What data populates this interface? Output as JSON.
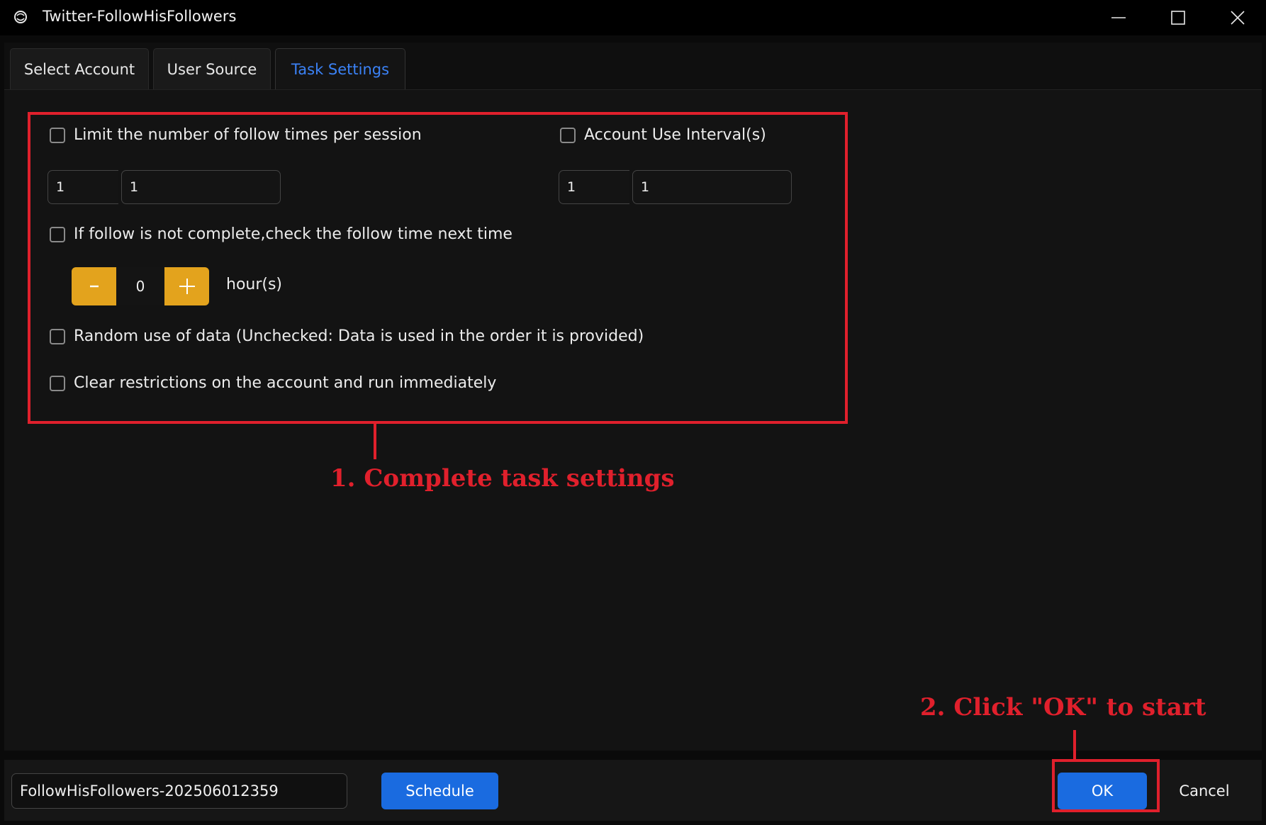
{
  "window": {
    "title": "Twitter-FollowHisFollowers",
    "icon": "app-logo-icon"
  },
  "tabs": [
    {
      "label": "Select Account",
      "active": false
    },
    {
      "label": "User Source",
      "active": false
    },
    {
      "label": "Task Settings",
      "active": true
    }
  ],
  "settings": {
    "limit_follow": {
      "label": "Limit the number of follow times per session",
      "checked": false,
      "min": "1",
      "max": "1"
    },
    "account_interval": {
      "label": "Account Use Interval(s)",
      "checked": false,
      "min": "1",
      "max": "1"
    },
    "follow_incomplete": {
      "label": "If follow is not complete,check the follow time next time",
      "checked": false,
      "hours": "0",
      "hours_label": "hour(s)"
    },
    "random_data": {
      "label": "Random use of data (Unchecked: Data is used in the order it is provided)",
      "checked": false
    },
    "clear_restrictions": {
      "label": "Clear restrictions on the account and run immediately",
      "checked": false
    }
  },
  "annotations": {
    "step1": "1. Complete task settings",
    "step2": "2. Click \"OK\" to start",
    "highlight_color": "#e0202c"
  },
  "footer": {
    "task_name": "FollowHisFollowers-202506012359",
    "schedule_label": "Schedule",
    "ok_label": "OK",
    "cancel_label": "Cancel"
  },
  "colors": {
    "accent_blue": "#1a6be0",
    "active_tab_text": "#3b82f6",
    "stepper_orange": "#e3a31d"
  }
}
